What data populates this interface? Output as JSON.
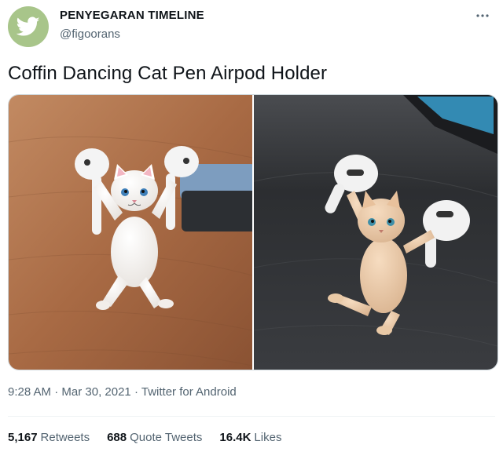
{
  "author": {
    "name": "PENYEGARAN TIMELINE",
    "handle": "@figoorans",
    "avatar_icon": "twitter-bird-icon"
  },
  "tweet": {
    "text": "Coffin Dancing Cat Pen Airpod Holder",
    "time": "9:28 AM",
    "date": "Mar 30, 2021",
    "source": "Twitter for Android",
    "separator": "·"
  },
  "stats": {
    "retweets_count": "5,167",
    "retweets_label": "Retweets",
    "quote_count": "688",
    "quote_label": "Quote Tweets",
    "likes_count": "16.4K",
    "likes_label": "Likes"
  },
  "colors": {
    "avatar_bg": "#a8c58a",
    "text_primary": "#0f1419",
    "text_secondary": "#536471",
    "border": "#cfd9de"
  }
}
